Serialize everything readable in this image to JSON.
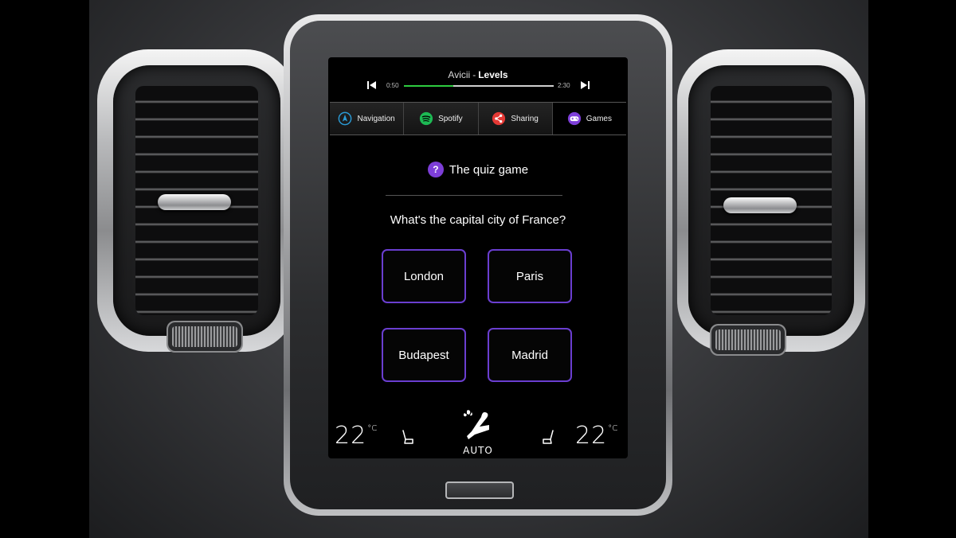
{
  "player": {
    "artist": "Avicii",
    "separator": "-",
    "song": "Levels",
    "elapsed": "0:50",
    "duration": "2:30",
    "progress": 0.33
  },
  "tabs": [
    {
      "label": "Navigation",
      "icon": "navigation-icon",
      "color": "#2a9bd6"
    },
    {
      "label": "Spotify",
      "icon": "spotify-icon",
      "color": "#1db954"
    },
    {
      "label": "Sharing",
      "icon": "share-icon",
      "color": "#e53935"
    },
    {
      "label": "Games",
      "icon": "gamepad-icon",
      "color": "#7d3ed8",
      "active": true
    }
  ],
  "quiz": {
    "icon": "question-icon",
    "title": "The quiz game",
    "question": "What's the capital city of France?",
    "answers": [
      "London",
      "Paris",
      "Budapest",
      "Madrid"
    ]
  },
  "climate": {
    "left_temp": "22",
    "right_temp": "22",
    "unit": "°C",
    "mode": "AUTO"
  },
  "colors": {
    "accent": "#7d3ed8",
    "progress": "#2ecc40",
    "answer_border": "#6a3ed0"
  }
}
